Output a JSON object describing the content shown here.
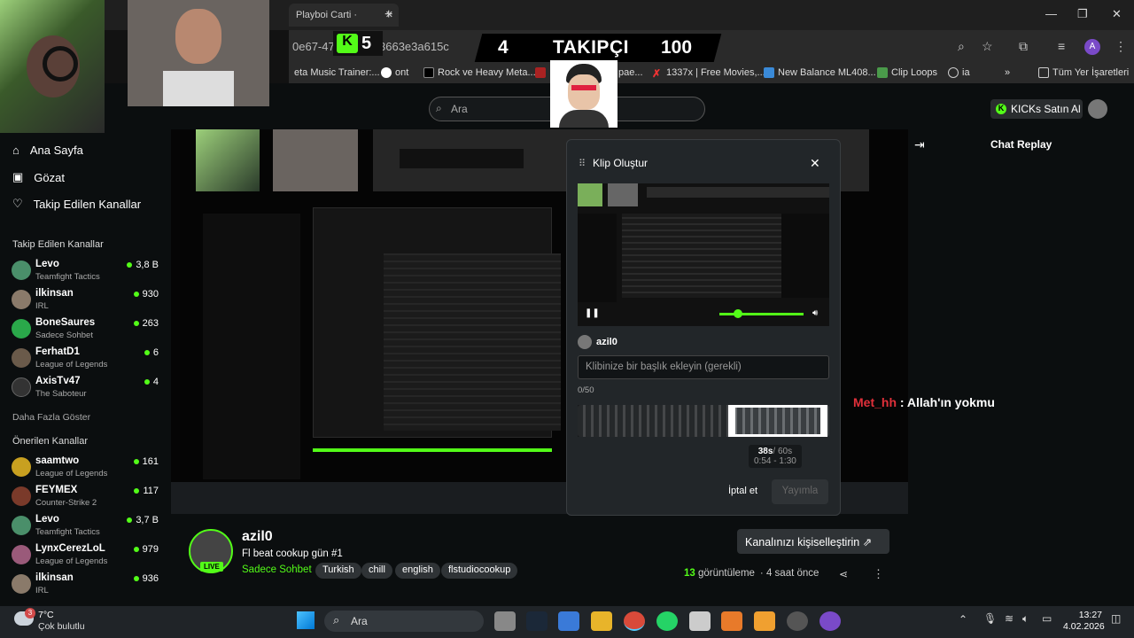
{
  "browser": {
    "tab_title": "Playboi Carti ·",
    "tab_close": "✕",
    "new_tab": "+",
    "url": "0e67-474",
    "url_tail": "3663e3a615c",
    "profile_initial": "A",
    "bookmarks": [
      "eta Music Trainer:...",
      "ont",
      "Rock ve Heavy Meta...",
      "pae...",
      "1337x | Free Movies,...",
      "New Balance ML408...",
      "Clip Loops",
      "ia"
    ],
    "all_bookmarks": "Tüm Yer İşaretleri"
  },
  "overlay": {
    "k_count": "5",
    "left_num": "4",
    "label": "TAKIPÇI",
    "right_num": "100"
  },
  "kick": {
    "search_placeholder": "Ara",
    "buy_kicks": "KICKs Satın Al",
    "nav": [
      {
        "label": "Ana Sayfa",
        "icon": "home-icon",
        "glyph": "⌂"
      },
      {
        "label": "Gözat",
        "icon": "browse-icon",
        "glyph": "▣"
      },
      {
        "label": "Takip Edilen Kanallar",
        "icon": "heart-icon",
        "glyph": "♡"
      }
    ],
    "followed_title": "Takip Edilen Kanallar",
    "followed": [
      {
        "name": "Levo",
        "cat": "Teamfight Tactics",
        "count": "3,8 B",
        "color": "#4a8f6a"
      },
      {
        "name": "ilkinsan",
        "cat": "IRL",
        "count": "930",
        "color": "#8a7a6a"
      },
      {
        "name": "BoneSaures",
        "cat": "Sadece Sohbet",
        "count": "263",
        "color": "#2aa84a"
      },
      {
        "name": "FerhatD1",
        "cat": "League of Legends",
        "count": "6",
        "color": "#6a5a4a"
      },
      {
        "name": "AxisTv47",
        "cat": "The Saboteur",
        "count": "4",
        "color": "#222"
      }
    ],
    "show_more": "Daha Fazla Göster",
    "recommended_title": "Önerilen Kanallar",
    "recommended": [
      {
        "name": "saamtwo",
        "cat": "League of Legends",
        "count": "161",
        "color": "#c8a020"
      },
      {
        "name": "FEYMEX",
        "cat": "Counter-Strike 2",
        "count": "117",
        "color": "#7a3a2a"
      },
      {
        "name": "Levo",
        "cat": "Teamfight Tactics",
        "count": "3,7 B",
        "color": "#4a8f6a"
      },
      {
        "name": "LynxCerezLoL",
        "cat": "League of Legends",
        "count": "979",
        "color": "#9a5a7a"
      },
      {
        "name": "ilkinsan",
        "cat": "IRL",
        "count": "936",
        "color": "#8a7a6a"
      }
    ],
    "chat_replay": "Chat Replay",
    "chat_user": "Met_hh",
    "chat_text": " : Allah'ın yokmu",
    "modal": {
      "title": "Klip Oluştur",
      "user": "azil0",
      "placeholder": "Klibinize bir başlık ekleyin (gerekli)",
      "counter": "0/50",
      "duration": "38s",
      "duration_max": "/ 60s",
      "range": "0:54 - 1:30",
      "cancel": "İptal et",
      "publish": "Yayımla"
    },
    "stream": {
      "streamer": "azil0",
      "title": "Fl beat cookup gün #1",
      "category": "Sadece Sohbet",
      "tags": [
        "Turkish",
        "chill",
        "english",
        "flstudiocookup"
      ],
      "live": "LIVE",
      "customize": "Kanalınızı kişiselleştirin ⇗",
      "views_num": "13",
      "views": " görüntüleme",
      "ago": "4 saat önce"
    }
  },
  "taskbar": {
    "temp": "7°C",
    "weather": "Çok bulutlu",
    "badge": "3",
    "search": "Ara",
    "time": "13:27",
    "date": "4.02.2026"
  }
}
